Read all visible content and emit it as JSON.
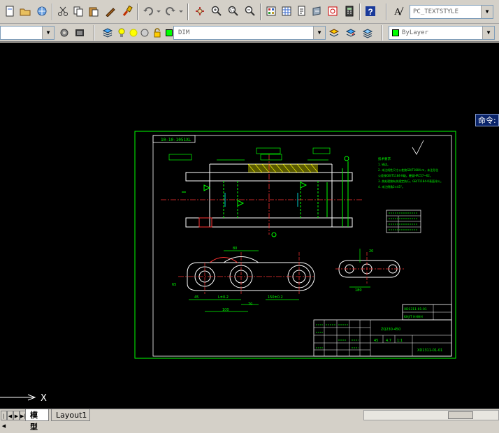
{
  "toolbar_top": {
    "text_style": "PC_TEXTSTYLE",
    "icons": [
      "new-file-icon",
      "open-file-icon",
      "publish-icon",
      "cut-icon",
      "copy-icon",
      "paste-icon",
      "match-properties-icon",
      "brush-icon",
      "undo-icon",
      "redo-icon",
      "pan-icon",
      "zoom-realtime-icon",
      "zoom-window-icon",
      "zoom-previous-icon",
      "properties-icon",
      "design-center-icon",
      "tool-palettes-icon",
      "sheet-set-icon",
      "markup-icon",
      "calculator-icon",
      "help-icon",
      "text-style-icon"
    ]
  },
  "toolbar_layers": {
    "layer_name": "DIM",
    "color": "ByLayer",
    "icons": [
      "workspace-settings-icon",
      "layer-manager-icon",
      "lightbulb-icon",
      "sun-icon",
      "lock-icon",
      "color-square-icon",
      "layer-previous-icon",
      "layer-states-icon",
      "make-current-icon"
    ]
  },
  "command_line": {
    "label": "命令:"
  },
  "ucs": {
    "x_label": "X"
  },
  "layout_tabs": {
    "model": "模型",
    "layout1": "Layout1"
  },
  "drawing": {
    "title_tag": "10-10-1051XL",
    "notes_title": "技术要求",
    "notes": [
      "1. 锐边。",
      "2. 未注线性尺寸公差按GB/T1804-m，未注形位",
      "   公差按GB/T1184-K级。硬度HRC57~62。",
      "3. 热处理按有关规定执行，GB/T1184-K表面淬火。",
      "4. 未注倒角2×45°。"
    ],
    "dims": [
      "80",
      "45",
      "65",
      "R1",
      "150±0.2",
      "L±0.2",
      "100",
      "20",
      "70",
      "1",
      "150",
      "180"
    ],
    "title_block": {
      "drawing_no": "XD1311-01-01",
      "part": "ZQ230-450",
      "company": "KHJIT HHHH",
      "material": "45",
      "scale": "1:1",
      "qty": "1",
      "count": "4.7"
    },
    "colors": {
      "frame": "#00ff00",
      "outline": "#ffffff",
      "dims": "#00ff00",
      "center": "#ff3333",
      "hatch": "#ffff00",
      "cyan": "#00ffff"
    }
  }
}
